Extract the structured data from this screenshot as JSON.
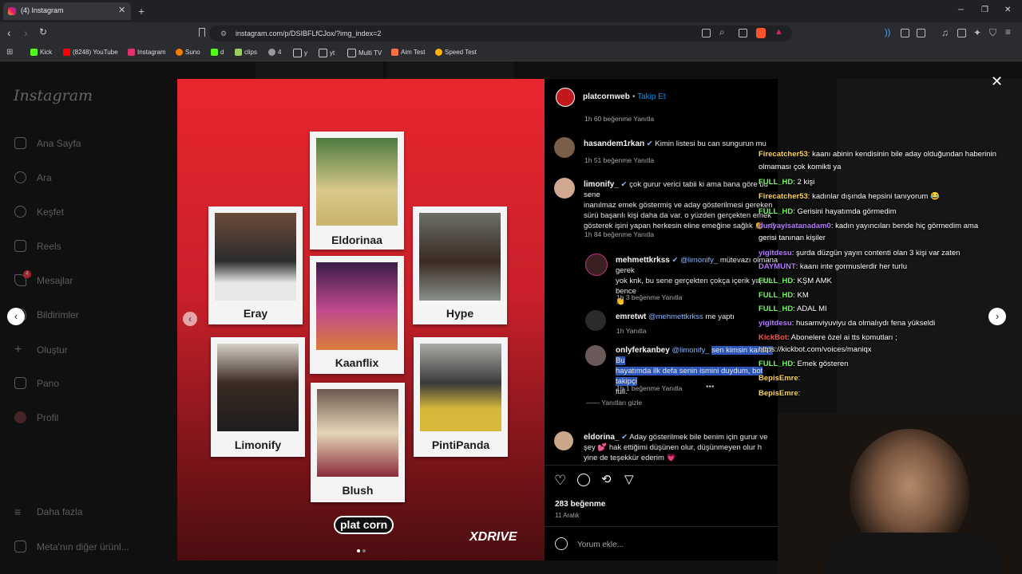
{
  "browser": {
    "tab_title": "(4) Instagram",
    "url": "instagram.com/p/DSIBFLfCJox/?img_index=2",
    "bookmarks": [
      "Kick",
      "(8248) YouTube",
      "Instagram",
      "Suno",
      "d",
      "clips",
      "4",
      "y",
      "yt",
      "Multi TV",
      "Aim Test",
      "Speed Test"
    ]
  },
  "sidebar": {
    "logo": "Instagram",
    "items": [
      "Ana Sayfa",
      "Ara",
      "Keşfet",
      "Reels",
      "Mesajlar",
      "Bildirimler",
      "Oluştur",
      "Pano",
      "Profil"
    ],
    "messages_badge": "4",
    "more": "Daha fazla",
    "meta": "Meta'nın diğer ürünl..."
  },
  "post": {
    "people": [
      "Eldorinaa",
      "Eray",
      "Kaanflix",
      "Hype",
      "Limonify",
      "Blush",
      "PintiPanda"
    ],
    "logo_left": "plat corn",
    "logo_right": "XDRIVE"
  },
  "panel": {
    "author": "platcornweb",
    "follow": "Takip Et",
    "author_meta": "1h   60 beğenme   Yanıtla",
    "comments": [
      {
        "user": "hasandem1rkan",
        "text": "Kimin listesi bu can sungurun mu",
        "meta": "1h   51 beğenme   Yanıtla"
      },
      {
        "user": "limonify_",
        "text1": "çok gurur verici tabii ki ama bana göre bu sene",
        "text2": "inanılmaz emek göstermiş ve aday gösterilmesi gereken",
        "text3": "sürü başarılı kişi daha da var. o yüzden gerçekten emek",
        "text4": "gösterek işini yapan herkesin eline emeğine sağlık 👏 <3",
        "meta": "1h   84 beğenme   Yanıtla"
      },
      {
        "user": "mehmettkrkss",
        "mention": "@limonify_",
        "text1": "mütevazı olmana gerek",
        "text2": "yok knk, bu sene gerçekten çokça içerik yaptın bence",
        "meta": "1h   3 beğenme   Yanıtla"
      },
      {
        "user": "emretwt",
        "mention": "@mehmettkrkss",
        "text": "me yaptı",
        "meta": "1h   Yanıtla"
      },
      {
        "user": "onlyferkanbey",
        "mention": "@limonify_",
        "text1": "sen kimsin karde? Bu",
        "text2": "hayatımda ilk defa senin ismini duydum, bot takipçi",
        "text3": "full.",
        "meta": "1h   1 beğenme   Yanıtla"
      },
      {
        "user": "eldorina_",
        "text1": "Aday gösterilmek bile benim için gurur ve",
        "text2": "şey 💕 hak ettiğimi düşünen olur, düşünmeyen olur h",
        "text3": "yine de teşekkür ederim 💗"
      }
    ],
    "hide_replies": "Yanıtları gizle",
    "likes": "283 beğenme",
    "date": "11 Aralık",
    "comment_placeholder": "Yorum ekle..."
  },
  "chat": [
    {
      "user": "Firecatcher53",
      "text": ": kaanı abinin kendisinin bile aday olduğundan haberinin"
    },
    {
      "user": "",
      "text": "olmaması çok komikti ya"
    },
    {
      "user": "FULL_HD",
      "text": ": 2 kişi"
    },
    {
      "user": "Firecatcher53",
      "text": ": kadınlar dışında hepsini tanıyorum 😂"
    },
    {
      "user": "FULL_HD",
      "text": ": Gerisini hayatımda görmedim"
    },
    {
      "user": "dunyayisatanadam0",
      "text": ": kadın yayıncıları bende hiç görmedim ama"
    },
    {
      "user": "",
      "text": "gerisi tanınan kişiler"
    },
    {
      "user": "yigitdesu",
      "text": ": şurda düzgün yayın contenti olan 3 kişi var zaten"
    },
    {
      "user": "DAYMUNT",
      "text": ": kaanı inte gormuslerdir her turlu"
    },
    {
      "user": "FULL_HD",
      "text": ": KŞM AMK"
    },
    {
      "user": "FULL_HD",
      "text": ": KM"
    },
    {
      "user": "FULL_HD",
      "text": ": ADAL MI"
    },
    {
      "user": "yigitdesu",
      "text": ": husamviyuviyu da olmalıydı fena yükseldi"
    },
    {
      "user": "KickBot",
      "text": ": Abonelere özel ai tts komutları ;"
    },
    {
      "user": "",
      "text": "https://kickbot.com/voices/maniqx"
    },
    {
      "user": "FULL_HD",
      "text": ": Emek gösteren"
    },
    {
      "user": "BepisEmre",
      "text": ":"
    },
    {
      "user": "BepisEmre",
      "text": ":"
    }
  ],
  "colors": {
    "accent": "#0095f6",
    "chat_user": "#6aff56",
    "post_red": "#e8262e"
  }
}
